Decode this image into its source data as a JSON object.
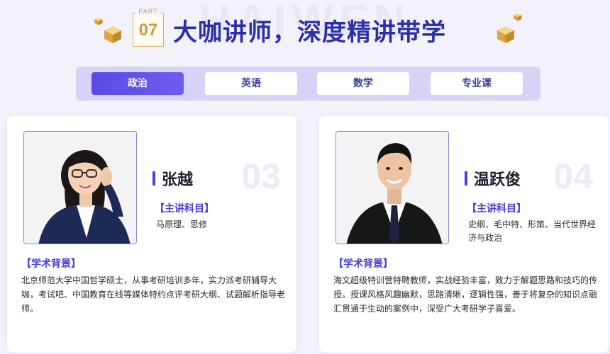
{
  "header": {
    "part_label": "PART",
    "part_number": "07",
    "title": "大咖讲师，深度精讲带学",
    "watermark": "HAIWEN"
  },
  "tabs": [
    {
      "label": "政治",
      "active": true
    },
    {
      "label": "英语",
      "active": false
    },
    {
      "label": "数学",
      "active": false
    },
    {
      "label": "专业课",
      "active": false
    }
  ],
  "teachers": [
    {
      "name": "张越",
      "number": "03",
      "subject_heading": "【主讲科目】",
      "subjects": "马原理、思修",
      "background_heading": "【学术背景】",
      "background": "北京师范大学中国哲学硕士，从事考研培训多年，实力派考研辅导大咖，考试吧、中国教育在线等媒体特约点评考研大纲、试题解析指导老师。"
    },
    {
      "name": "温跃俊",
      "number": "04",
      "subject_heading": "【主讲科目】",
      "subjects": "史纲、毛中特、形策、当代世界经济与政治",
      "background_heading": "【学术背景】",
      "background": "海文超级特训营特聘教师，实战经验丰富，致力于解题思路和技巧的传授。授课风格风趣幽默，思路清晰，逻辑性强，善于将复杂的知识点融汇贯通于生动的案例中，深受广大考研学子喜爱。"
    }
  ],
  "colors": {
    "accent": "#4a3fe0",
    "title": "#2b2fa8",
    "tab_bar": "#d8d3f6",
    "gold": "#d09a3c"
  },
  "icons": [
    "gold-cube-icon",
    "name-accent-bar"
  ]
}
